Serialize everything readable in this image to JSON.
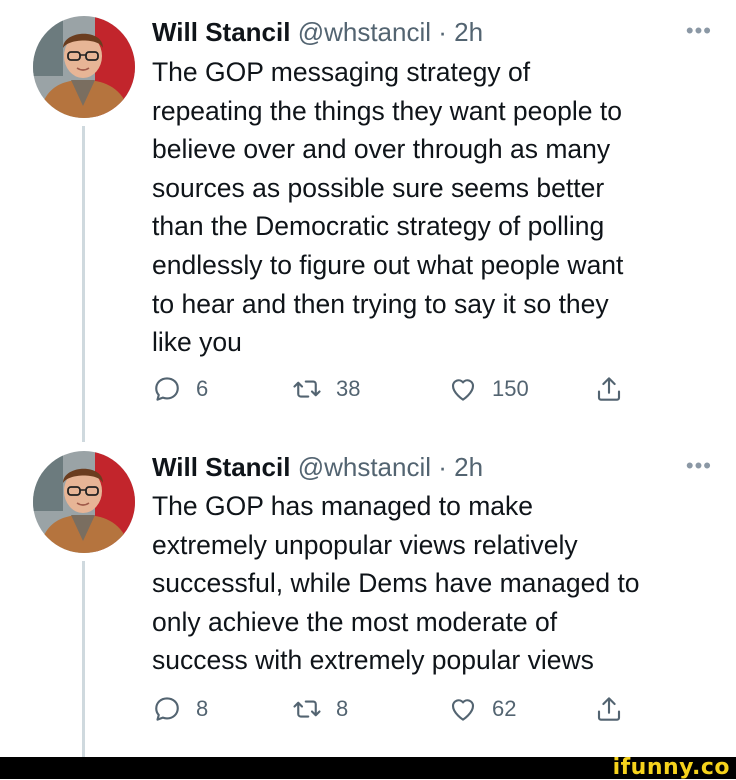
{
  "tweets": [
    {
      "name": "Will Stancil",
      "handle": "@whstancil",
      "separator": "·",
      "time": "2h",
      "more": "•••",
      "text_lines": [
        "The GOP messaging strategy of",
        "repeating the things they want people to",
        "believe over and over through as many",
        "sources as possible sure seems better",
        "than the Democratic strategy of polling",
        "endlessly to figure out what people want",
        "to hear and then trying to say it so they",
        "like you"
      ],
      "replies": "6",
      "retweets": "38",
      "likes": "150"
    },
    {
      "name": "Will Stancil",
      "handle": "@whstancil",
      "separator": "·",
      "time": "2h",
      "more": "•••",
      "text_lines": [
        "The GOP has managed to make",
        "extremely unpopular views relatively",
        "successful, while Dems have managed to",
        "only achieve the most moderate of",
        "success with extremely popular views"
      ],
      "replies": "8",
      "retweets": "8",
      "likes": "62"
    }
  ],
  "watermark": "ifunny.co",
  "colors": {
    "text": "#0f1419",
    "secondary": "#536471",
    "thread": "#cfd9de",
    "watermark": "#f5d21c"
  }
}
